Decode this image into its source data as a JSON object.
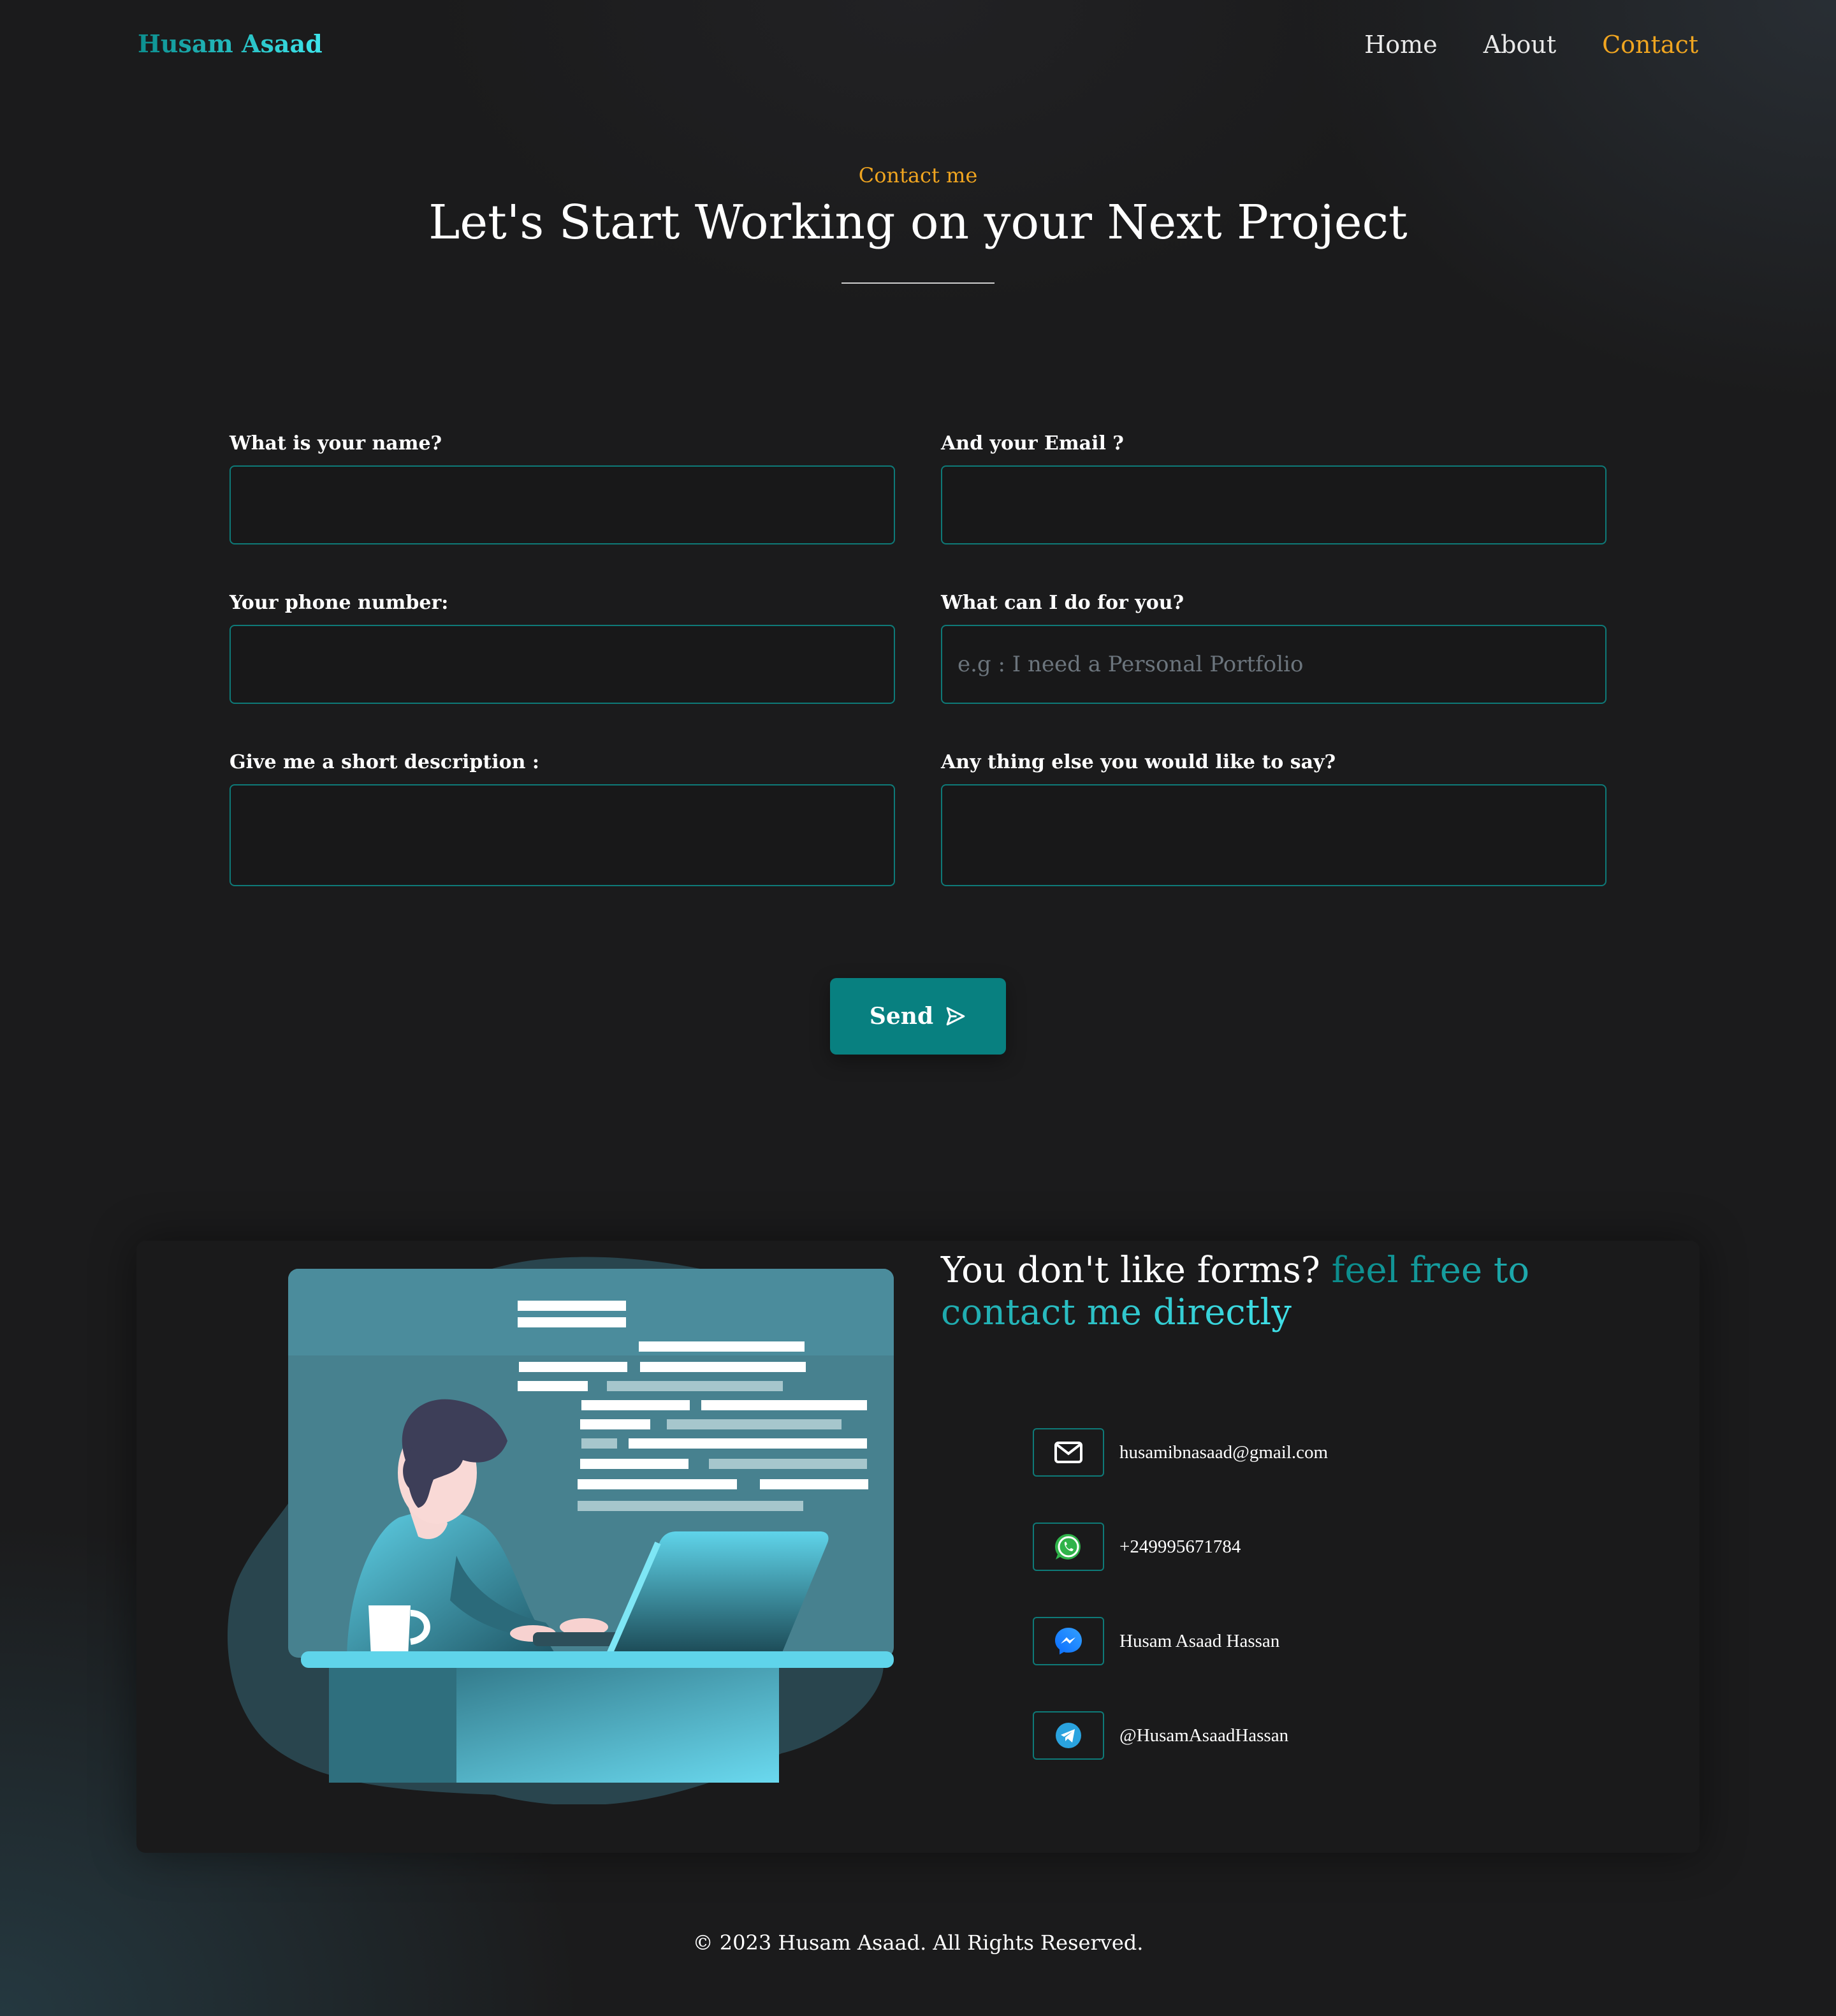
{
  "nav": {
    "logo": "Husam Asaad",
    "links": [
      "Home",
      "About",
      "Contact"
    ],
    "active": "Contact"
  },
  "header": {
    "eyebrow": "Contact me",
    "title": "Let's Start Working on your Next Project"
  },
  "form": {
    "name_label": "What is your name?",
    "email_label": "And your Email ?",
    "phone_label": "Your phone number:",
    "service_label": "What can I do for you?",
    "service_placeholder": "e.g : I need a Personal Portfolio",
    "description_label": "Give me a short description :",
    "extra_label": "Any thing else you would like to say?",
    "send_label": "Send"
  },
  "direct": {
    "lead": "You don't like forms?",
    "highlight": "feel free to contact me directly"
  },
  "contacts": [
    {
      "icon": "mail-icon",
      "text": "husamibnasaad@gmail.com"
    },
    {
      "icon": "whatsapp-icon",
      "text": "+249995671784"
    },
    {
      "icon": "messenger-icon",
      "text": "Husam Asaad Hassan"
    },
    {
      "icon": "telegram-icon",
      "text": "@HusamAsaadHassan"
    }
  ],
  "footer": "© 2023 Husam Asaad. All Rights Reserved.",
  "colors": {
    "accent_teal": "#088080",
    "accent_orange": "#f0a520",
    "background": "#1b1b1c"
  }
}
